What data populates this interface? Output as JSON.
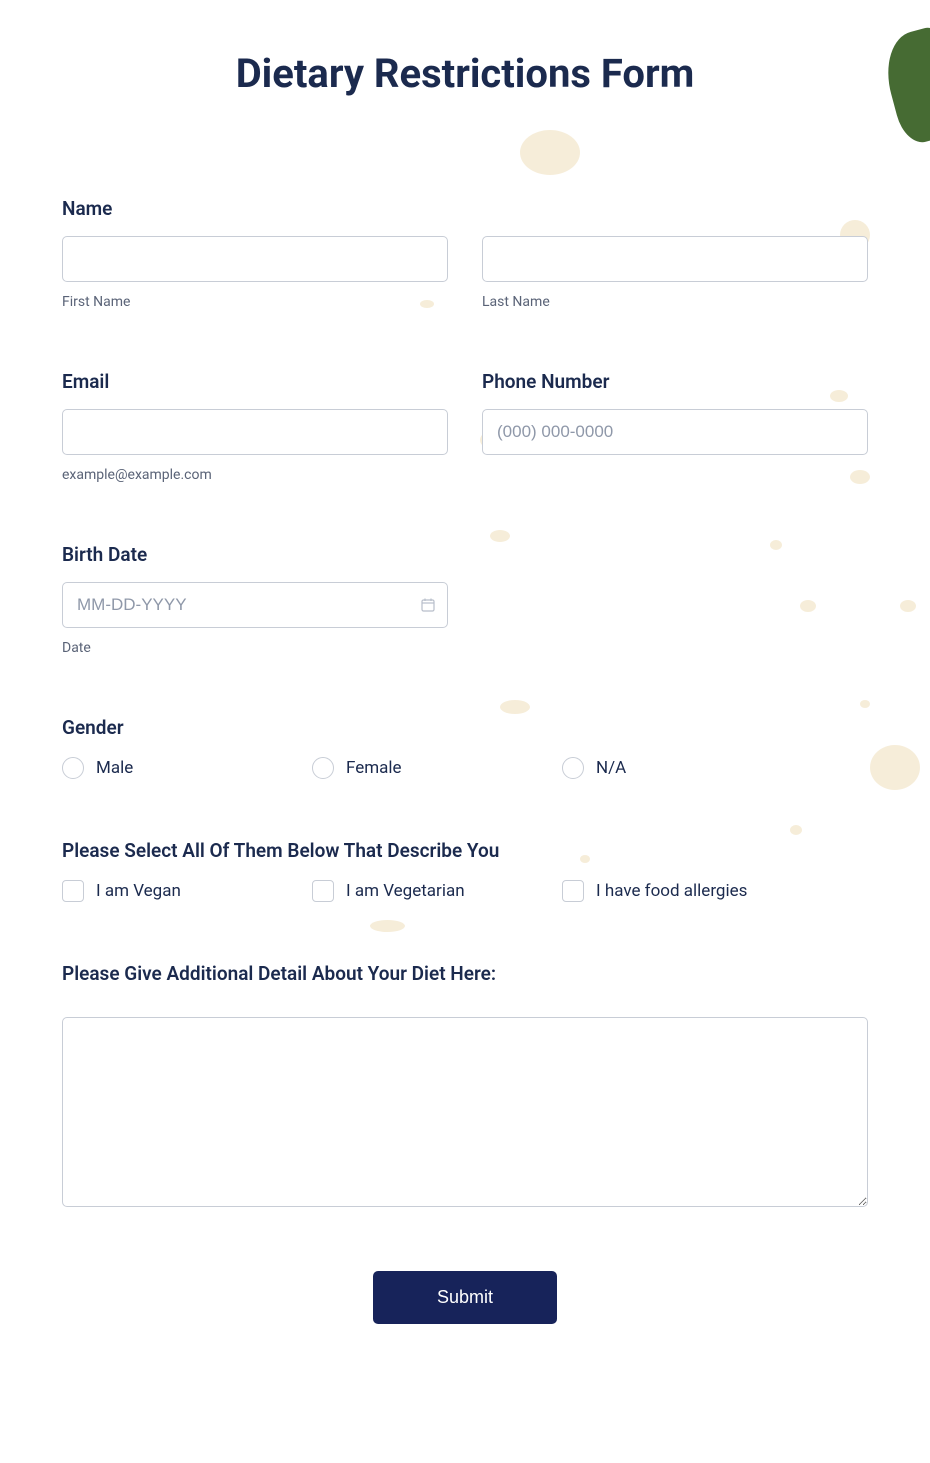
{
  "title": "Dietary Restrictions Form",
  "name": {
    "label": "Name",
    "first_sublabel": "First Name",
    "last_sublabel": "Last Name"
  },
  "email": {
    "label": "Email",
    "sublabel": "example@example.com"
  },
  "phone": {
    "label": "Phone Number",
    "placeholder": "(000) 000-0000"
  },
  "birthdate": {
    "label": "Birth Date",
    "placeholder": "MM-DD-YYYY",
    "sublabel": "Date"
  },
  "gender": {
    "label": "Gender",
    "options": [
      "Male",
      "Female",
      "N/A"
    ]
  },
  "diet_describe": {
    "label": "Please Select All Of Them Below That Describe You",
    "options": [
      "I am Vegan",
      "I am Vegetarian",
      "I have food allergies"
    ]
  },
  "additional": {
    "label": "Please Give Additional Detail About Your Diet Here:"
  },
  "submit_label": "Submit"
}
